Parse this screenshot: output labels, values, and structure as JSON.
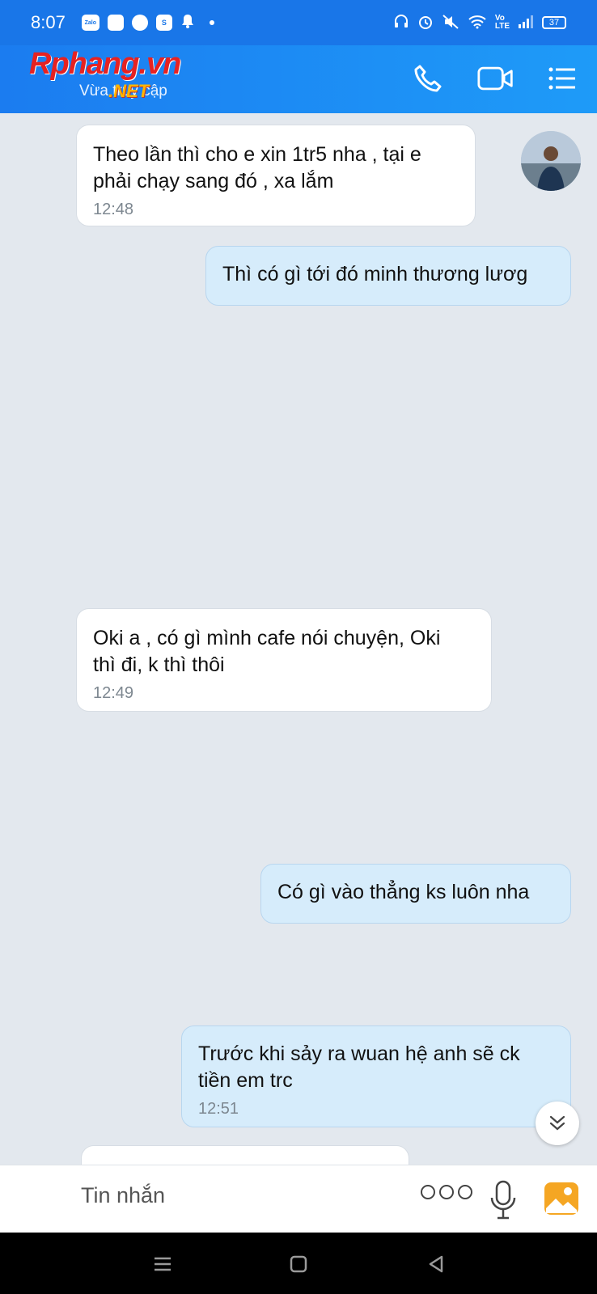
{
  "status_bar": {
    "time": "8:07",
    "app_icons": [
      "Zalo",
      "messenger-icon",
      "chat-icon",
      "shopee-icon",
      "bell-icon"
    ],
    "battery": "37"
  },
  "header": {
    "watermark_logo": "Rphang.vn",
    "watermark_net": ".NET",
    "subtitle": "Vừa truy cập",
    "accent_color": "#1976e8"
  },
  "messages": [
    {
      "direction": "in",
      "text": "Theo lần thì cho e xin 1tr5 nha , tại e\nphải chạy sang đó , xa lắm",
      "time": "12:48"
    },
    {
      "direction": "out",
      "text": "Thì có gì tới đó minh thương lươg",
      "time": ""
    },
    {
      "direction": "in",
      "text": "Oki a , có gì mình cafe nói chuyện, Oki\nthì đi, k thì thôi",
      "time": "12:49"
    },
    {
      "direction": "out",
      "text": "Có gì vào thẳng ks luôn nha",
      "time": ""
    },
    {
      "direction": "out",
      "text": "Trước khi sảy ra wuan hệ anh sẽ ck\ntiền em trc",
      "time": "12:51"
    }
  ],
  "input": {
    "placeholder": "Tin nhắn"
  }
}
